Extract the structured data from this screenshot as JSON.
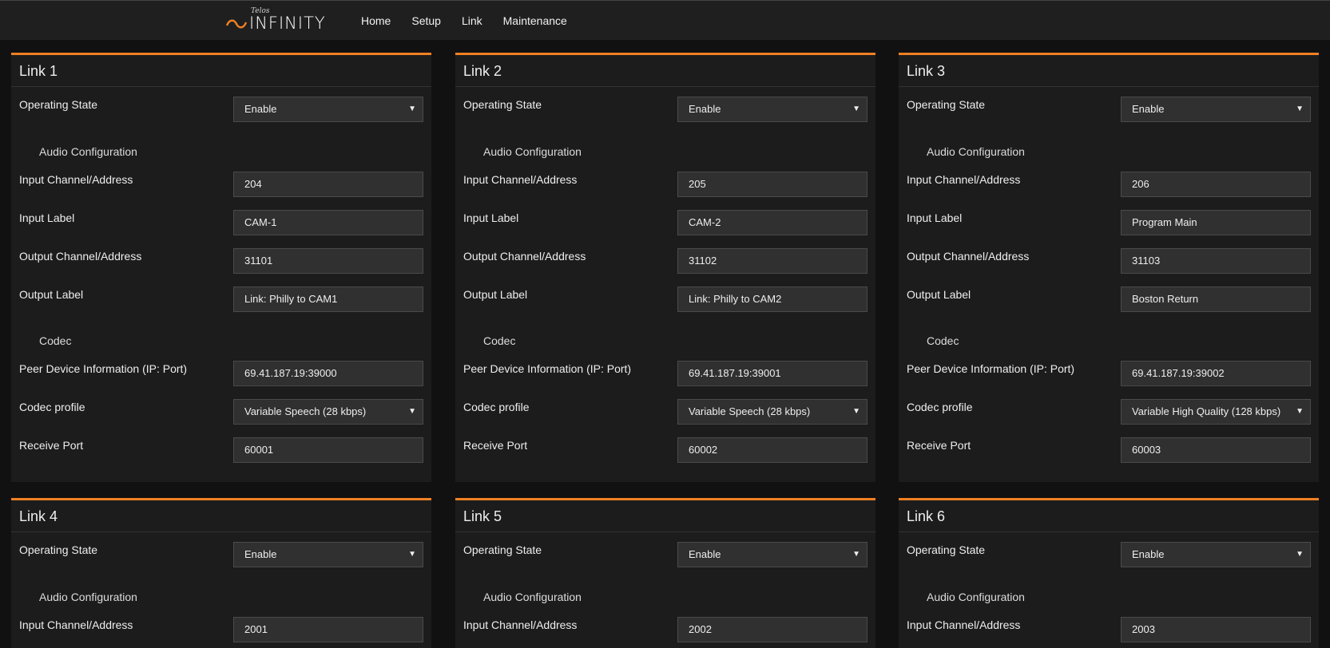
{
  "brand": {
    "tagline": "Telos",
    "name": "INFINITY"
  },
  "nav": {
    "home": "Home",
    "setup": "Setup",
    "link": "Link",
    "maintenance": "Maintenance"
  },
  "labels": {
    "operating_state": "Operating State",
    "audio_configuration": "Audio Configuration",
    "input_channel": "Input Channel/Address",
    "input_label": "Input Label",
    "output_channel": "Output Channel/Address",
    "output_label": "Output Label",
    "codec": "Codec",
    "peer_device": "Peer Device Information (IP: Port)",
    "codec_profile": "Codec profile",
    "receive_port": "Receive Port"
  },
  "links": [
    {
      "title": "Link 1",
      "operating_state": "Enable",
      "input_channel": "204",
      "input_label": "CAM-1",
      "output_channel": "31101",
      "output_label": "Link: Philly to CAM1",
      "peer_device": "69.41.187.19:39000",
      "codec_profile": "Variable Speech (28 kbps)",
      "receive_port": "60001"
    },
    {
      "title": "Link 2",
      "operating_state": "Enable",
      "input_channel": "205",
      "input_label": "CAM-2",
      "output_channel": "31102",
      "output_label": "Link: Philly to CAM2",
      "peer_device": "69.41.187.19:39001",
      "codec_profile": "Variable Speech (28 kbps)",
      "receive_port": "60002"
    },
    {
      "title": "Link 3",
      "operating_state": "Enable",
      "input_channel": "206",
      "input_label": "Program Main",
      "output_channel": "31103",
      "output_label": "Boston Return",
      "peer_device": "69.41.187.19:39002",
      "codec_profile": "Variable High Quality (128 kbps)",
      "receive_port": "60003"
    },
    {
      "title": "Link 4",
      "operating_state": "Enable",
      "input_channel": "2001"
    },
    {
      "title": "Link 5",
      "operating_state": "Enable",
      "input_channel": "2002"
    },
    {
      "title": "Link 6",
      "operating_state": "Enable",
      "input_channel": "2003"
    }
  ],
  "colors": {
    "accent": "#f08023",
    "background": "#111111",
    "panel": "#1c1c1c",
    "field": "#303030"
  },
  "icons": {
    "logo": "telos-arc-logo-icon",
    "select": "caret-down-icon"
  }
}
